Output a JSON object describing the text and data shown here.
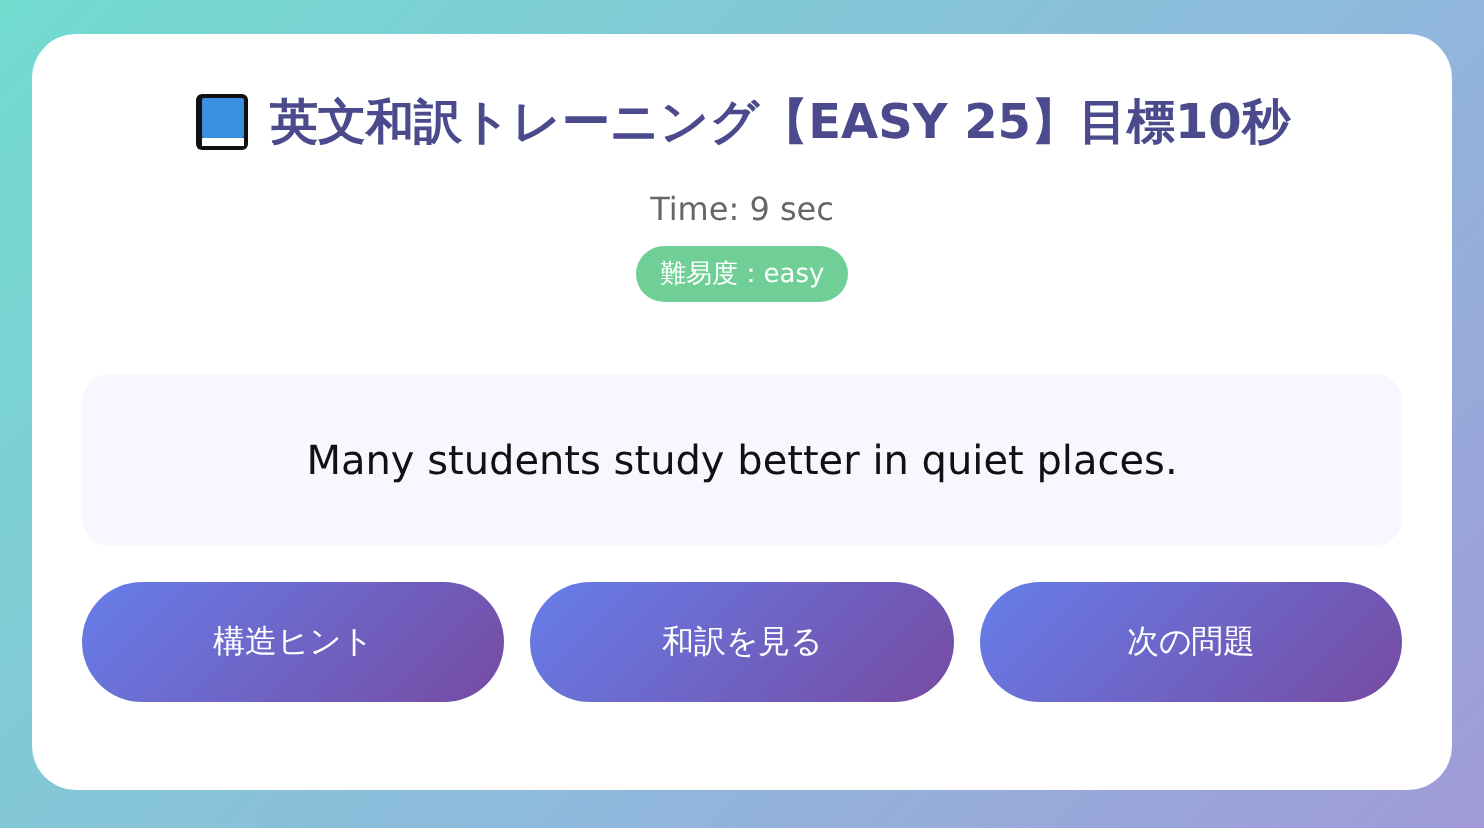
{
  "title": "英文和訳トレーニング【EASY 25】目標10秒",
  "timer": "Time: 9 sec",
  "difficulty_badge": "難易度：easy",
  "sentence": "Many students study better in quiet places.",
  "buttons": [
    "構造ヒント",
    "和訳を見る",
    "次の問題"
  ]
}
